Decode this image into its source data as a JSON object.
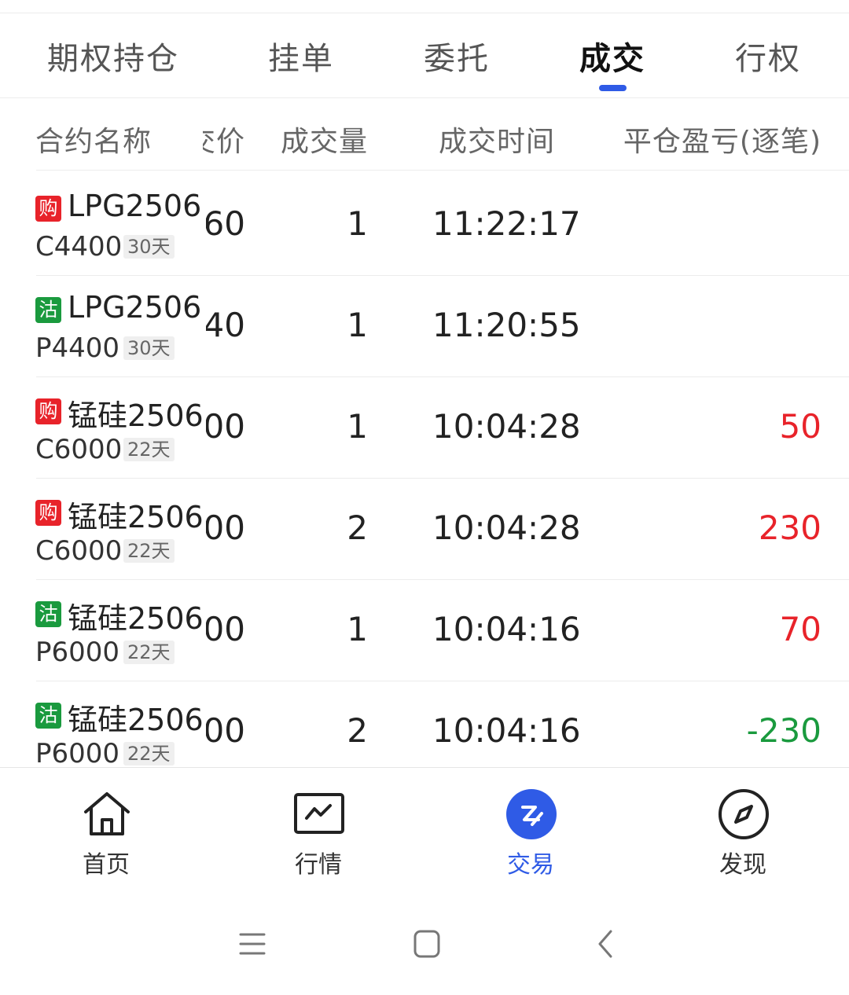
{
  "tabs": [
    {
      "label": "期权持仓",
      "active": false
    },
    {
      "label": "挂单",
      "active": false
    },
    {
      "label": "委托",
      "active": false
    },
    {
      "label": "成交",
      "active": true
    },
    {
      "label": "行权",
      "active": false
    }
  ],
  "columns": {
    "name": "合约名称",
    "price": "成交价",
    "qty": "成交量",
    "time": "成交时间",
    "pnl": "平仓盈亏(逐笔)"
  },
  "rows": [
    {
      "badge": "购",
      "side": "buy",
      "name": "LPG2506",
      "strike": "C4400",
      "days": "30天",
      "price": "60",
      "qty": "1",
      "time": "11:22:17",
      "pnl": ""
    },
    {
      "badge": "沽",
      "side": "sell",
      "name": "LPG2506",
      "strike": "P4400",
      "days": "30天",
      "price": "40",
      "qty": "1",
      "time": "11:20:55",
      "pnl": ""
    },
    {
      "badge": "购",
      "side": "buy",
      "name": "锰硅2506",
      "strike": "C6000",
      "days": "22天",
      "price": "00",
      "qty": "1",
      "time": "10:04:28",
      "pnl": "50"
    },
    {
      "badge": "购",
      "side": "buy",
      "name": "锰硅2506",
      "strike": "C6000",
      "days": "22天",
      "price": "00",
      "qty": "2",
      "time": "10:04:28",
      "pnl": "230"
    },
    {
      "badge": "沽",
      "side": "sell",
      "name": "锰硅2506",
      "strike": "P6000",
      "days": "22天",
      "price": "00",
      "qty": "1",
      "time": "10:04:16",
      "pnl": "70"
    },
    {
      "badge": "沽",
      "side": "sell",
      "name": "锰硅2506",
      "strike": "P6000",
      "days": "22天",
      "price": "00",
      "qty": "2",
      "time": "10:04:16",
      "pnl": "-230"
    }
  ],
  "nav": [
    {
      "label": "首页",
      "icon": "home-icon",
      "active": false
    },
    {
      "label": "行情",
      "icon": "chart-icon",
      "active": false
    },
    {
      "label": "交易",
      "icon": "trade-icon",
      "active": true
    },
    {
      "label": "发现",
      "icon": "compass-icon",
      "active": false
    }
  ],
  "colors": {
    "accent": "#2f5be6",
    "up": "#e8232a",
    "down": "#1a9a3e"
  }
}
